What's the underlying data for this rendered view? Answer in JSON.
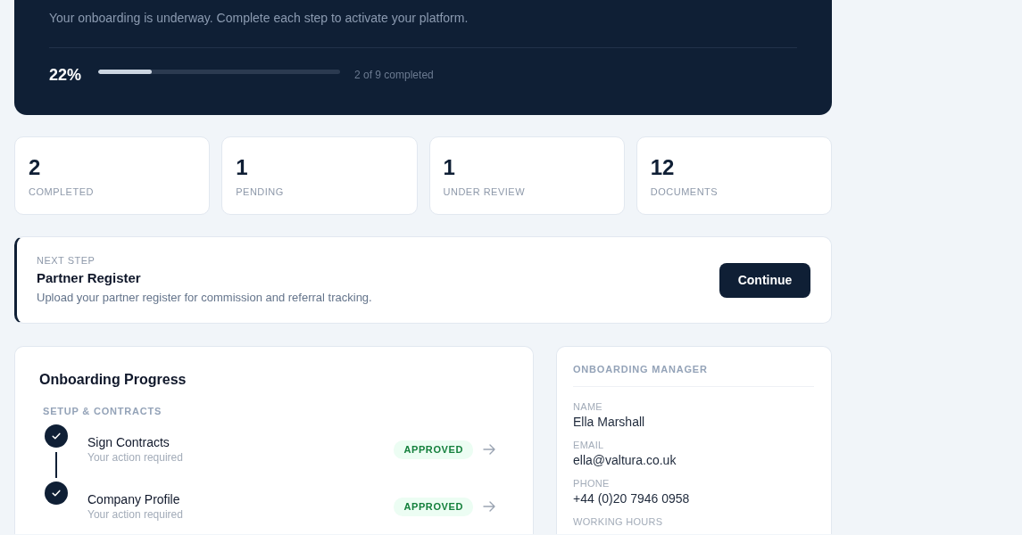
{
  "banner": {
    "subtitle": "Your onboarding is underway. Complete each step to activate your platform.",
    "percent": "22%",
    "progress": {
      "level": 0.22
    },
    "summary": "2 of 9 completed"
  },
  "stats": [
    {
      "value": "2",
      "label": "COMPLETED"
    },
    {
      "value": "1",
      "label": "PENDING"
    },
    {
      "value": "1",
      "label": "UNDER REVIEW"
    },
    {
      "value": "12",
      "label": "DOCUMENTS"
    }
  ],
  "next_step": {
    "eyebrow": "NEXT STEP",
    "title": "Partner Register",
    "description": "Upload your partner register for commission and referral tracking.",
    "button": "Continue"
  },
  "progress_card": {
    "title": "Onboarding Progress",
    "groups": [
      {
        "heading": "SETUP & CONTRACTS",
        "steps": [
          {
            "title": "Sign Contracts",
            "subtitle": "Your action required",
            "done": true,
            "kind": "approved",
            "status": "APPROVED"
          },
          {
            "title": "Company Profile",
            "subtitle": "Your action required",
            "done": true,
            "kind": "approved",
            "status": "APPROVED"
          }
        ]
      }
    ]
  },
  "manager": {
    "heading": "ONBOARDING MANAGER",
    "fields": [
      {
        "label": "NAME",
        "value": "Ella Marshall"
      },
      {
        "label": "EMAIL",
        "value": "ella@valtura.co.uk"
      },
      {
        "label": "PHONE",
        "value": "+44 (0)20 7946 0958"
      },
      {
        "label": "WORKING HOURS"
      }
    ]
  }
}
